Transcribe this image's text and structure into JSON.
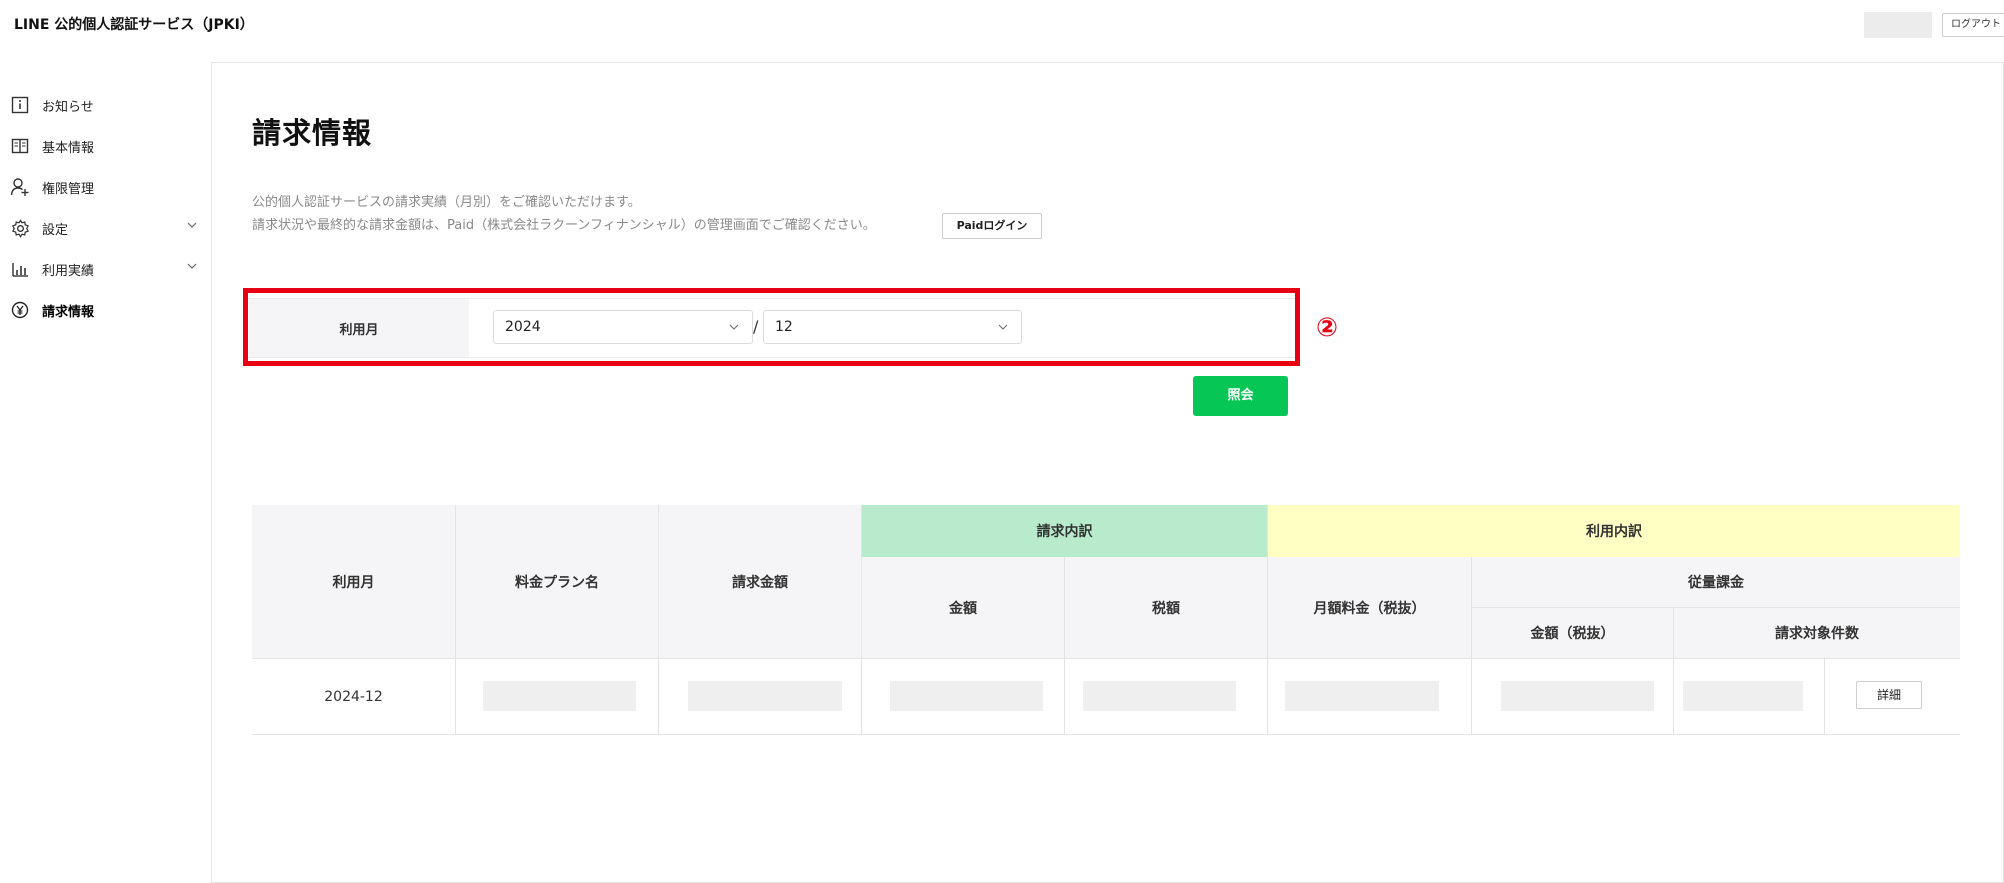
{
  "header": {
    "app_title": "LINE 公的個人認証サービス（JPKI）",
    "logout_label": "ログアウト"
  },
  "sidebar": {
    "items": [
      {
        "label": "お知らせ",
        "icon": "info-icon",
        "active": false,
        "expandable": false
      },
      {
        "label": "基本情報",
        "icon": "book-icon",
        "active": false,
        "expandable": false
      },
      {
        "label": "権限管理",
        "icon": "user-add-icon",
        "active": false,
        "expandable": false
      },
      {
        "label": "設定",
        "icon": "gear-icon",
        "active": false,
        "expandable": true
      },
      {
        "label": "利用実績",
        "icon": "bar-chart-icon",
        "active": false,
        "expandable": true
      },
      {
        "label": "請求情報",
        "icon": "yen-icon",
        "active": true,
        "expandable": false
      }
    ]
  },
  "main": {
    "title": "請求情報",
    "description_line1": "公的個人認証サービスの請求実績（月別）をご確認いただけます。",
    "description_line2": "請求状況や最終的な請求金額は、Paid（株式会社ラクーンフィナンシャル）の管理画面でご確認ください。",
    "paid_login_label": "Paidログイン",
    "filter": {
      "label": "利用月",
      "year_value": "2024",
      "month_value": "12",
      "separator": "/"
    },
    "annotation_number": "②",
    "search_button_label": "照会",
    "accent_color": "#06c755",
    "highlight_color": "#e60012"
  },
  "table": {
    "headers": {
      "usage_month": "利用月",
      "plan_name": "料金プラン名",
      "billing_amount": "請求金額",
      "billing_breakdown": "請求内訳",
      "usage_breakdown": "利用内訳",
      "amount": "金額",
      "tax": "税額",
      "monthly_fee": "月額料金（税抜）",
      "metered_billing": "従量課金",
      "amount_excl_tax": "金額（税抜）",
      "billable_count": "請求対象件数"
    },
    "rows": [
      {
        "usage_month": "2024-12",
        "detail_label": "詳細"
      }
    ]
  }
}
